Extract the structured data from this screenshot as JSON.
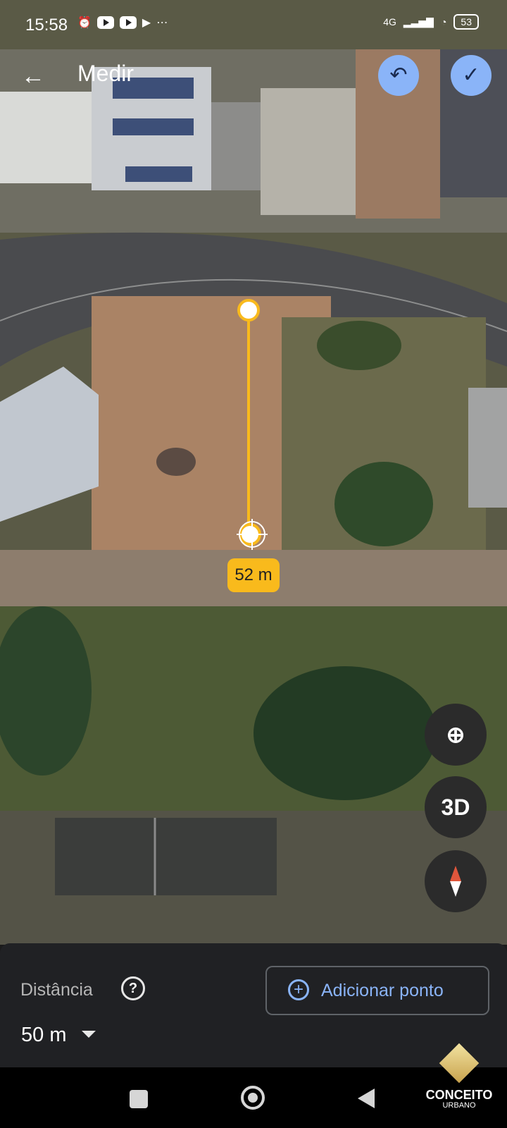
{
  "status": {
    "time": "15:58",
    "network": "4G",
    "battery": "53",
    "icons": [
      "alarm-icon",
      "youtube-icon",
      "youtube-icon",
      "play-store-icon",
      "more-icon",
      "signal-icon",
      "wifi-icon",
      "battery-icon"
    ]
  },
  "toolbar": {
    "back_icon": "arrow-left-icon",
    "title": "Medir",
    "undo_icon": "undo-icon",
    "done_icon": "check-icon"
  },
  "map": {
    "measure_label": "52 m",
    "line_color": "#f9ba1c",
    "buttons": {
      "location_icon": "my-location-icon",
      "three_d_label": "3D",
      "compass_icon": "compass-icon"
    }
  },
  "panel": {
    "distance_label": "Distância",
    "help_icon": "question-icon",
    "add_point_label": "Adicionar ponto",
    "scale_value": "50 m"
  },
  "watermark": {
    "title": "CONCEITO",
    "subtitle": "URBANO"
  },
  "colors": {
    "accent": "#8ab4f8",
    "chip": "#f9ba1c",
    "panel": "#202124"
  }
}
